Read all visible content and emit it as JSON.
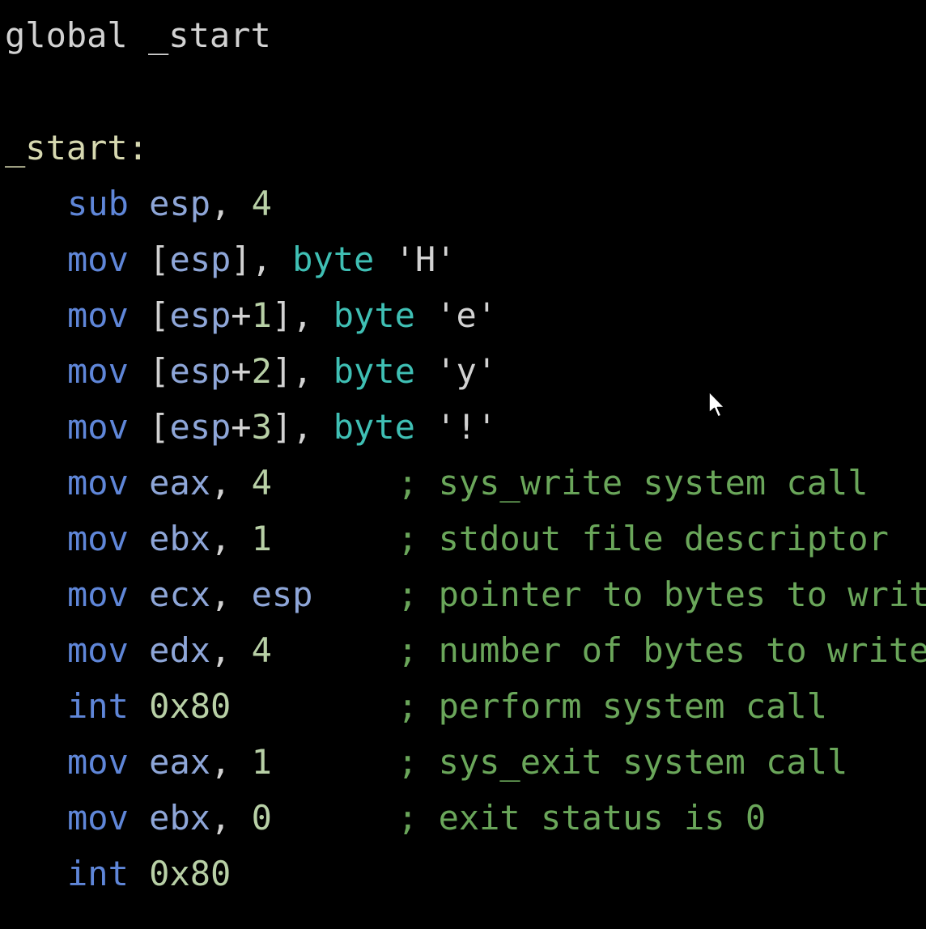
{
  "colors": {
    "background": "#000000",
    "directive": "#d2d2d2",
    "label": "#d6d8b0",
    "instruction": "#5f86d8",
    "register": "#8ea6d8",
    "number": "#b8d0a6",
    "string": "#d2d2d2",
    "size_keyword": "#3fbfb4",
    "punctuation": "#d2d2d2",
    "comment": "#6aa65a"
  },
  "cursor_icon": "mouse-pointer-icon",
  "lines": [
    {
      "tokens": [
        {
          "text": "global",
          "kind": "directive"
        },
        {
          "text": " ",
          "kind": "punctuation"
        },
        {
          "text": "_start",
          "kind": "directive"
        }
      ]
    },
    {
      "tokens": [
        {
          "text": "_start:",
          "kind": "label"
        }
      ]
    },
    {
      "tokens": [
        {
          "text": "sub",
          "kind": "instruction"
        },
        {
          "text": " ",
          "kind": "punctuation"
        },
        {
          "text": "esp",
          "kind": "register"
        },
        {
          "text": ", ",
          "kind": "punctuation"
        },
        {
          "text": "4",
          "kind": "number"
        }
      ]
    },
    {
      "tokens": [
        {
          "text": "mov",
          "kind": "instruction"
        },
        {
          "text": " [",
          "kind": "punctuation"
        },
        {
          "text": "esp",
          "kind": "register"
        },
        {
          "text": "], ",
          "kind": "punctuation"
        },
        {
          "text": "byte",
          "kind": "size_keyword"
        },
        {
          "text": " ",
          "kind": "punctuation"
        },
        {
          "text": "'H'",
          "kind": "string"
        }
      ]
    },
    {
      "tokens": [
        {
          "text": "mov",
          "kind": "instruction"
        },
        {
          "text": " [",
          "kind": "punctuation"
        },
        {
          "text": "esp",
          "kind": "register"
        },
        {
          "text": "+",
          "kind": "punctuation"
        },
        {
          "text": "1",
          "kind": "number"
        },
        {
          "text": "], ",
          "kind": "punctuation"
        },
        {
          "text": "byte",
          "kind": "size_keyword"
        },
        {
          "text": " ",
          "kind": "punctuation"
        },
        {
          "text": "'e'",
          "kind": "string"
        }
      ]
    },
    {
      "tokens": [
        {
          "text": "mov",
          "kind": "instruction"
        },
        {
          "text": " [",
          "kind": "punctuation"
        },
        {
          "text": "esp",
          "kind": "register"
        },
        {
          "text": "+",
          "kind": "punctuation"
        },
        {
          "text": "2",
          "kind": "number"
        },
        {
          "text": "], ",
          "kind": "punctuation"
        },
        {
          "text": "byte",
          "kind": "size_keyword"
        },
        {
          "text": " ",
          "kind": "punctuation"
        },
        {
          "text": "'y'",
          "kind": "string"
        }
      ]
    },
    {
      "tokens": [
        {
          "text": "mov",
          "kind": "instruction"
        },
        {
          "text": " [",
          "kind": "punctuation"
        },
        {
          "text": "esp",
          "kind": "register"
        },
        {
          "text": "+",
          "kind": "punctuation"
        },
        {
          "text": "3",
          "kind": "number"
        },
        {
          "text": "], ",
          "kind": "punctuation"
        },
        {
          "text": "byte",
          "kind": "size_keyword"
        },
        {
          "text": " ",
          "kind": "punctuation"
        },
        {
          "text": "'!'",
          "kind": "string"
        }
      ]
    },
    {
      "tokens": [
        {
          "text": "mov",
          "kind": "instruction"
        },
        {
          "text": " ",
          "kind": "punctuation"
        },
        {
          "text": "eax",
          "kind": "register"
        },
        {
          "text": ", ",
          "kind": "punctuation"
        },
        {
          "text": "4",
          "kind": "number"
        }
      ],
      "comment": "; sys_write system call"
    },
    {
      "tokens": [
        {
          "text": "mov",
          "kind": "instruction"
        },
        {
          "text": " ",
          "kind": "punctuation"
        },
        {
          "text": "ebx",
          "kind": "register"
        },
        {
          "text": ", ",
          "kind": "punctuation"
        },
        {
          "text": "1",
          "kind": "number"
        }
      ],
      "comment": "; stdout file descriptor"
    },
    {
      "tokens": [
        {
          "text": "mov",
          "kind": "instruction"
        },
        {
          "text": " ",
          "kind": "punctuation"
        },
        {
          "text": "ecx",
          "kind": "register"
        },
        {
          "text": ", ",
          "kind": "punctuation"
        },
        {
          "text": "esp",
          "kind": "register"
        }
      ],
      "comment": "; pointer to bytes to write"
    },
    {
      "tokens": [
        {
          "text": "mov",
          "kind": "instruction"
        },
        {
          "text": " ",
          "kind": "punctuation"
        },
        {
          "text": "edx",
          "kind": "register"
        },
        {
          "text": ", ",
          "kind": "punctuation"
        },
        {
          "text": "4",
          "kind": "number"
        }
      ],
      "comment": "; number of bytes to write"
    },
    {
      "tokens": [
        {
          "text": "int",
          "kind": "instruction"
        },
        {
          "text": " ",
          "kind": "punctuation"
        },
        {
          "text": "0x80",
          "kind": "number"
        }
      ],
      "comment": "; perform system call"
    },
    {
      "tokens": [
        {
          "text": "mov",
          "kind": "instruction"
        },
        {
          "text": " ",
          "kind": "punctuation"
        },
        {
          "text": "eax",
          "kind": "register"
        },
        {
          "text": ", ",
          "kind": "punctuation"
        },
        {
          "text": "1",
          "kind": "number"
        }
      ],
      "comment": "; sys_exit system call"
    },
    {
      "tokens": [
        {
          "text": "mov",
          "kind": "instruction"
        },
        {
          "text": " ",
          "kind": "punctuation"
        },
        {
          "text": "ebx",
          "kind": "register"
        },
        {
          "text": ", ",
          "kind": "punctuation"
        },
        {
          "text": "0",
          "kind": "number"
        }
      ],
      "comment": "; exit status is 0"
    },
    {
      "tokens": [
        {
          "text": "int",
          "kind": "instruction"
        },
        {
          "text": " ",
          "kind": "punctuation"
        },
        {
          "text": "0x80",
          "kind": "number"
        }
      ]
    }
  ]
}
